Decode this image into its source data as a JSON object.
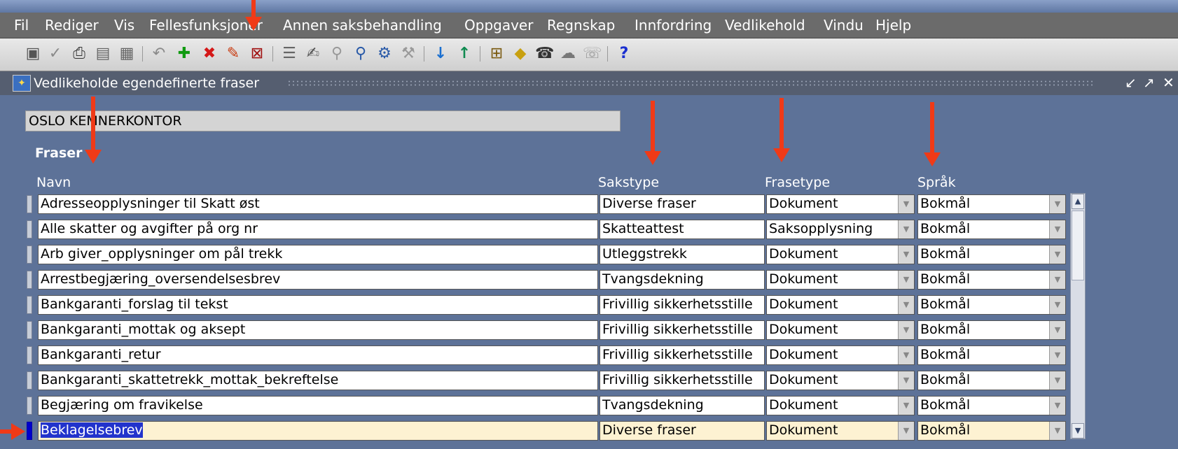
{
  "menu": {
    "items": [
      "Fil",
      "Rediger",
      "Vis",
      "Fellesfunksjoner",
      "Annen saksbehandling",
      "Oppgaver",
      "Regnskap",
      "Innfordring",
      "Vedlikehold",
      "Vindu",
      "Hjelp"
    ]
  },
  "toolbar": {
    "icons": [
      "save-icon",
      "check-icon",
      "print-icon",
      "page-icon",
      "pages-icon",
      "undo-icon",
      "add-record-icon",
      "delete-record-icon",
      "edit-icon",
      "clear-icon",
      "list-icon",
      "edit-field-icon",
      "query-icon",
      "find-icon",
      "help-query-icon",
      "tools-icon",
      "next-record-icon",
      "previous-record-icon",
      "tree-icon",
      "attachment-icon",
      "phone-icon",
      "chat-icon",
      "fax-icon",
      "help-icon"
    ]
  },
  "window": {
    "title": "Vedlikeholde egendefinerte fraser",
    "controls": [
      "↙",
      "↗",
      "✕"
    ]
  },
  "org": {
    "name": "OSLO KEMNERKONTOR"
  },
  "section": {
    "title": "Fraser"
  },
  "columns": {
    "name": "Navn",
    "sakstype": "Sakstype",
    "frasetype": "Frasetype",
    "sprak": "Språk"
  },
  "rows": [
    {
      "name": "Adresseopplysninger til Skatt øst",
      "sakstype": "Diverse fraser",
      "frasetype": "Dokument",
      "sprak": "Bokmål"
    },
    {
      "name": "Alle skatter og avgifter på org nr",
      "sakstype": "Skatteattest",
      "frasetype": "Saksopplysning",
      "sprak": "Bokmål"
    },
    {
      "name": "Arb giver_opplysninger om pål trekk",
      "sakstype": "Utleggstrekk",
      "frasetype": "Dokument",
      "sprak": "Bokmål"
    },
    {
      "name": "Arrestbegjæring_oversendelsesbrev",
      "sakstype": "Tvangsdekning",
      "frasetype": "Dokument",
      "sprak": "Bokmål"
    },
    {
      "name": "Bankgaranti_forslag til tekst",
      "sakstype": "Frivillig sikkerhetsstille",
      "frasetype": "Dokument",
      "sprak": "Bokmål"
    },
    {
      "name": "Bankgaranti_mottak og aksept",
      "sakstype": "Frivillig sikkerhetsstille",
      "frasetype": "Dokument",
      "sprak": "Bokmål"
    },
    {
      "name": "Bankgaranti_retur",
      "sakstype": "Frivillig sikkerhetsstille",
      "frasetype": "Dokument",
      "sprak": "Bokmål"
    },
    {
      "name": "Bankgaranti_skattetrekk_mottak_bekreftelse",
      "sakstype": "Frivillig sikkerhetsstille",
      "frasetype": "Dokument",
      "sprak": "Bokmål"
    },
    {
      "name": "Begjæring om fravikelse",
      "sakstype": "Tvangsdekning",
      "frasetype": "Dokument",
      "sprak": "Bokmål"
    },
    {
      "name": "Beklagelsebrev",
      "sakstype": "Diverse fraser",
      "frasetype": "Dokument",
      "sprak": "Bokmål",
      "selected": true
    }
  ],
  "colors": {
    "annotation_arrow": "#f03a17",
    "background": "#5d7298",
    "selected_row": "#fdf2d2",
    "selection": "#2233cc"
  }
}
